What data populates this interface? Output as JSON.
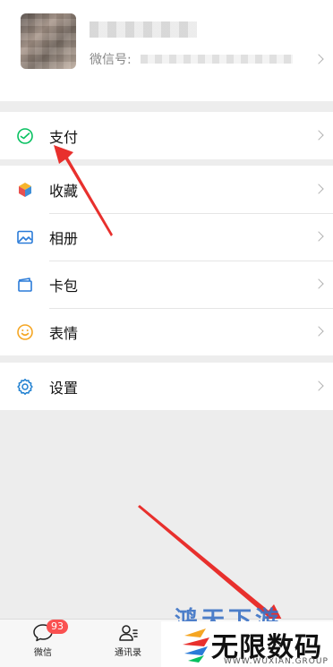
{
  "profile": {
    "wxid_label": "微信号:"
  },
  "menu": {
    "pay": "支付",
    "favorites": "收藏",
    "album": "相册",
    "cards": "卡包",
    "stickers": "表情",
    "settings": "设置"
  },
  "tabbar": {
    "chats": {
      "label": "微信",
      "badge": "93"
    },
    "contacts": {
      "label": "通讯录"
    }
  },
  "watermark": {
    "back_text": "鸿天下游",
    "title": "无限数码",
    "sub": "WWW.WUXIAN.GROUP"
  },
  "colors": {
    "accent_green": "#07c160",
    "arrow_red": "#e8302d",
    "badge_red": "#fa5151",
    "settings_blue": "#1e7fd0"
  }
}
